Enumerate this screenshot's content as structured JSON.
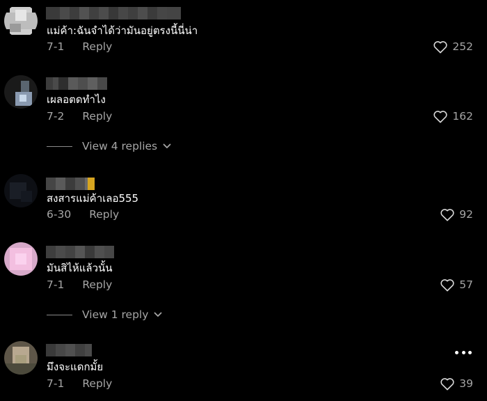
{
  "comments": [
    {
      "text": "แม่ค้า:ฉันจำได้ว่ามันอยู่ตรงนี้นี่น่า",
      "date": "7-1",
      "reply_label": "Reply",
      "likes": "252"
    },
    {
      "text": "เผลอตดทำไง",
      "date": "7-2",
      "reply_label": "Reply",
      "likes": "162",
      "view_replies": "View 4 replies"
    },
    {
      "text": "สงสารแม่ค้าเลอ555",
      "date": "6-30",
      "reply_label": "Reply",
      "likes": "92"
    },
    {
      "text": "มันสิไห้แล้วนั้น",
      "date": "7-1",
      "reply_label": "Reply",
      "likes": "57",
      "view_replies": "View 1 reply"
    },
    {
      "text": "มึงจะแดกมั้ย",
      "date": "7-1",
      "reply_label": "Reply",
      "likes": "39"
    }
  ],
  "colors": {
    "background": "#000000",
    "text": "#ffffff",
    "secondary": "#a6a6a6"
  },
  "icons": {
    "like": "heart-outline-icon",
    "expand": "chevron-down-icon",
    "more": "more-dots-icon"
  }
}
